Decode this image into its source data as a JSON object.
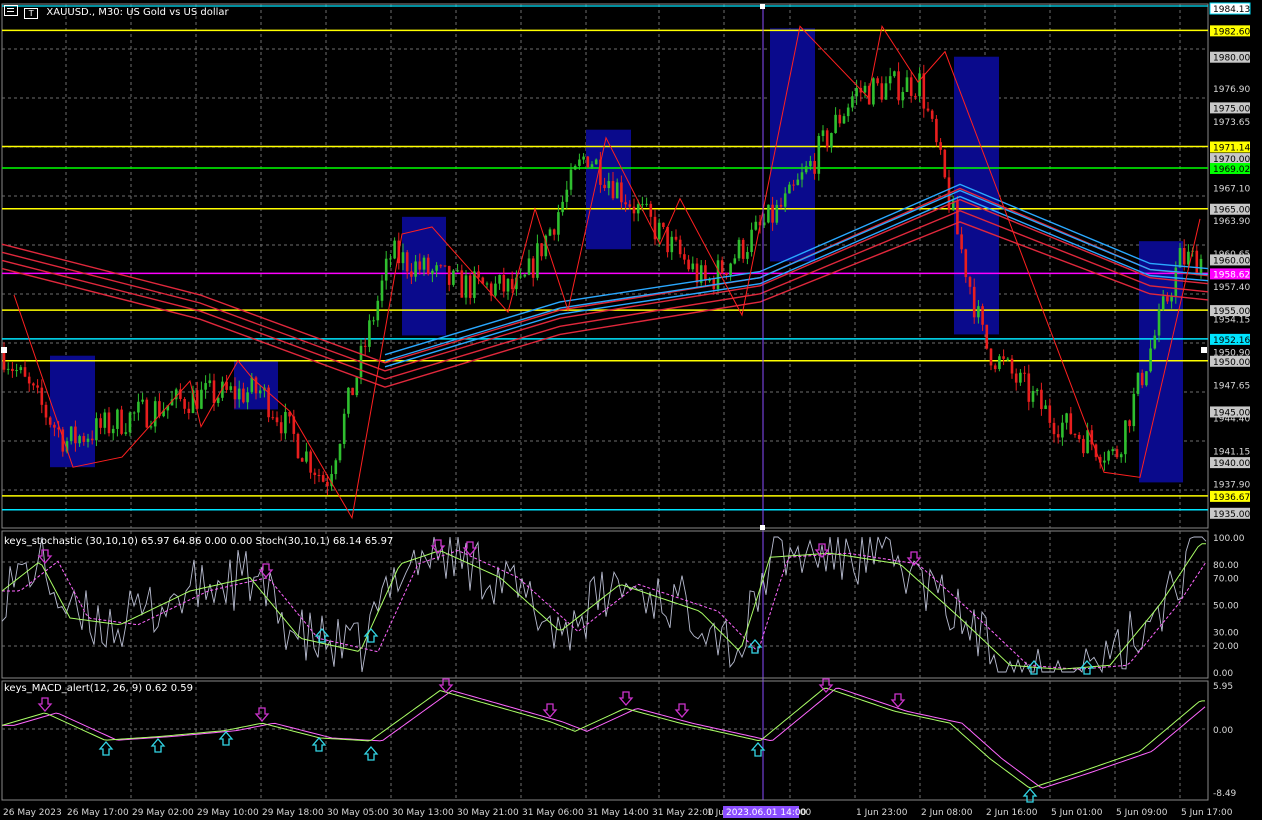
{
  "colors": {
    "background": "#000000",
    "grid": "#6e6e6e",
    "candle_up": "#2fbf2f",
    "candle_down": "#e81e1e",
    "zone_fill": "#0a0a8c",
    "ma_red": "#e0283c",
    "ma_blue": "#2aa8ff",
    "hline_yellow": "#ffff00",
    "hline_cyan": "#00e5ff",
    "hline_green": "#00ff00",
    "hline_magenta": "#ff00ff",
    "zigzag": "#ff2020",
    "cursor_line": "#8a4dff",
    "stoch_main": "#b8bcd0",
    "stoch_signal": "#aaff66",
    "stoch_dash": "#ff66ff",
    "macd_main": "#aaff66",
    "macd_signal": "#ff66ff",
    "arrow_down": "#cc33cc",
    "arrow_up": "#33d6e6"
  },
  "header": {
    "symbol_label": "XAUUSD., M30: US Gold vs US dollar",
    "window_icon_1": "chart-icon",
    "window_icon_2": "one-click-trading-icon"
  },
  "main_axis": {
    "ticks": [
      "1979.90",
      "1976.90",
      "1973.65",
      "1967.10",
      "1963.90",
      "1960.65",
      "1957.40",
      "1954.15",
      "1950.90",
      "1947.65",
      "1944.40",
      "1941.15",
      "1937.90"
    ]
  },
  "price_labels": [
    {
      "text": "1984.13",
      "kind": "cyan-box"
    },
    {
      "text": "1982.60",
      "kind": "yellow"
    },
    {
      "text": "1980.00",
      "kind": "gray"
    },
    {
      "text": "1975.00",
      "kind": "gray"
    },
    {
      "text": "1971.14",
      "kind": "yellow"
    },
    {
      "text": "1970.00",
      "kind": "gray"
    },
    {
      "text": "1969.02",
      "kind": "green"
    },
    {
      "text": "1965.00",
      "kind": "gray"
    },
    {
      "text": "1960.00",
      "kind": "gray"
    },
    {
      "text": "1958.62",
      "kind": "magenta"
    },
    {
      "text": "1955.00",
      "kind": "gray"
    },
    {
      "text": "1952.16",
      "kind": "cyan"
    },
    {
      "text": "1950.00",
      "kind": "gray"
    },
    {
      "text": "1945.00",
      "kind": "gray"
    },
    {
      "text": "1940.00",
      "kind": "gray"
    },
    {
      "text": "1936.67",
      "kind": "yellow"
    },
    {
      "text": "1935.00",
      "kind": "gray"
    }
  ],
  "hlines": [
    {
      "price": 1982.6,
      "color": "yellow"
    },
    {
      "price": 1971.14,
      "color": "yellow"
    },
    {
      "price": 1969.02,
      "color": "green"
    },
    {
      "price": 1965.0,
      "color": "yellow"
    },
    {
      "price": 1958.62,
      "color": "magenta"
    },
    {
      "price": 1955.0,
      "color": "yellow"
    },
    {
      "price": 1952.16,
      "color": "cyan"
    },
    {
      "price": 1950.0,
      "color": "yellow"
    },
    {
      "price": 1936.67,
      "color": "yellow"
    },
    {
      "price": 1935.3,
      "color": "cyan"
    }
  ],
  "stoch": {
    "title": "keys_stochastic (30,10,10) 65.97 64.86 0.00 0.00 Stoch(30,10,1) 68.14 65.97",
    "ticks": [
      "100.00",
      "80.00",
      "70.00",
      "50.00",
      "30.00",
      "20.00",
      "0.00"
    ]
  },
  "macd": {
    "title": "keys_MACD_alert(12, 26, 9) 0.62 0.59",
    "ticks": [
      "5.95",
      "0.00",
      "-8.49"
    ]
  },
  "time_axis": {
    "labels": [
      "26 May 2023",
      "26 May 17:00",
      "29 May 02:00",
      "29 May 10:00",
      "29 May 18:00",
      "30 May 05:00",
      "30 May 13:00",
      "30 May 21:00",
      "31 May 06:00",
      "31 May 14:00",
      "31 May 22:00",
      "1 Ju",
      "5:00",
      "1 Jun 23:00",
      "2 Jun 08:00",
      "2 Jun 16:00",
      "5 Jun 01:00",
      "5 Jun 09:00",
      "5 Jun 17:00"
    ],
    "cursor_label": "2023.06.01 14:00"
  },
  "chart_data": {
    "type": "candlestick",
    "symbol": "XAUUSD.",
    "timeframe": "M30",
    "title": "US Gold vs US dollar",
    "ylim": [
      1933.5,
      1985.2
    ],
    "close_path": [
      {
        "t": "26 May 2023",
        "close": 1951.0
      },
      {
        "t": "26 May 17:00",
        "close": 1942.0
      },
      {
        "t": "29 May 02:00",
        "close": 1944.5
      },
      {
        "t": "29 May 10:00",
        "close": 1946.5
      },
      {
        "t": "29 May 18:00",
        "close": 1947.0
      },
      {
        "t": "30 May 05:00",
        "close": 1938.0
      },
      {
        "t": "30 May 13:00",
        "close": 1960.5
      },
      {
        "t": "30 May 21:00",
        "close": 1957.5
      },
      {
        "t": "31 May 06:00",
        "close": 1957.0
      },
      {
        "t": "31 May 14:00",
        "close": 1970.5
      },
      {
        "t": "31 May 22:00",
        "close": 1963.5
      },
      {
        "t": "1 Jun 05:00",
        "close": 1957.5
      },
      {
        "t": "1 Jun 14:00",
        "close": 1966.0
      },
      {
        "t": "1 Jun 23:00",
        "close": 1976.5
      },
      {
        "t": "2 Jun 08:00",
        "close": 1977.5
      },
      {
        "t": "2 Jun 16:00",
        "close": 1951.5
      },
      {
        "t": "5 Jun 01:00",
        "close": 1944.5
      },
      {
        "t": "5 Jun 09:00",
        "close": 1940.5
      },
      {
        "t": "5 Jun 17:00",
        "close": 1960.0
      }
    ]
  }
}
